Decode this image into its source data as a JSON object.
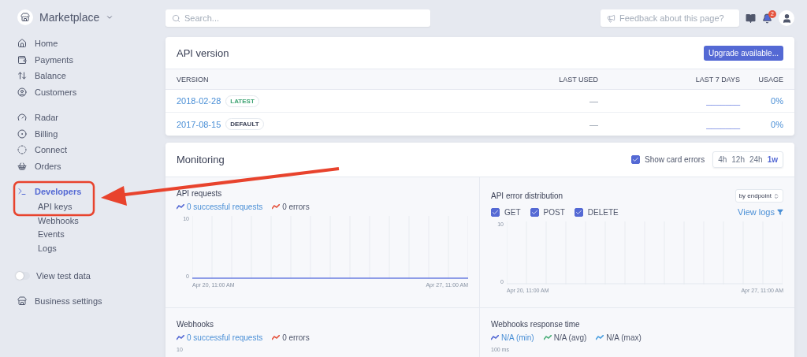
{
  "sidebar": {
    "account": "Marketplace",
    "groups": [
      [
        {
          "label": "Home",
          "selected": false
        },
        {
          "label": "Payments",
          "selected": false
        },
        {
          "label": "Balance",
          "selected": false
        },
        {
          "label": "Customers",
          "selected": false
        }
      ],
      [
        {
          "label": "Radar",
          "selected": false
        },
        {
          "label": "Billing",
          "selected": false
        },
        {
          "label": "Connect",
          "selected": false
        },
        {
          "label": "Orders",
          "selected": false
        }
      ],
      [
        {
          "label": "Developers",
          "selected": true,
          "children": [
            {
              "label": "API keys",
              "selected": false
            },
            {
              "label": "Webhooks",
              "selected": false
            },
            {
              "label": "Events",
              "selected": false
            },
            {
              "label": "Logs",
              "selected": false
            }
          ]
        }
      ]
    ],
    "test_data": {
      "label": "View test data",
      "on": false
    },
    "settings": {
      "label": "Business settings"
    }
  },
  "topbar": {
    "search": {
      "placeholder": "Search..."
    },
    "feedback": {
      "placeholder": "Feedback about this page?"
    },
    "notifications": "2"
  },
  "api_version": {
    "title": "API version",
    "button": "Upgrade available...",
    "columns": [
      "VERSION",
      "LAST USED",
      "LAST 7 DAYS",
      "USAGE"
    ],
    "rows": [
      {
        "version": "2018-02-28",
        "badge": {
          "text": "LATEST",
          "kind": "latest"
        },
        "last_used": "—",
        "last_7_days": "_______",
        "usage": "0%"
      },
      {
        "version": "2017-08-15",
        "badge": {
          "text": "DEFAULT",
          "kind": "default"
        },
        "last_used": "—",
        "last_7_days": "_______",
        "usage": "0%"
      }
    ]
  },
  "monitoring": {
    "title": "Monitoring",
    "show_card_errors": {
      "label": "Show card errors",
      "checked": true
    },
    "ranges": [
      {
        "label": "4h",
        "selected": false
      },
      {
        "label": "12h",
        "selected": false
      },
      {
        "label": "24h",
        "selected": false
      },
      {
        "label": "1w",
        "selected": true
      }
    ],
    "panels": [
      {
        "kind": "line",
        "title": "API requests",
        "legend": [
          {
            "text": "0 successful requests",
            "color": "#5469d4"
          },
          {
            "text": "0 errors",
            "color": "#e5533d"
          }
        ],
        "y_ticks": [
          "10",
          "0"
        ],
        "x_labels": [
          "Apr 20, 11:00 AM",
          "Apr 27, 11:00 AM"
        ]
      },
      {
        "kind": "distribution",
        "title": "API error distribution",
        "select": "by endpoint",
        "link": "View logs",
        "filters": [
          {
            "label": "GET",
            "checked": true
          },
          {
            "label": "POST",
            "checked": true
          },
          {
            "label": "DELETE",
            "checked": true
          }
        ],
        "y_ticks": [
          "10",
          "0"
        ],
        "x_labels": [
          "Apr 20, 11:00 AM",
          "Apr 27, 11:00 AM"
        ]
      },
      {
        "kind": "partial",
        "title": "Webhooks",
        "legend": [
          {
            "text": "0 successful requests",
            "color": "#5469d4"
          },
          {
            "text": "0 errors",
            "color": "#e5533d"
          }
        ],
        "y_ticks": [
          "10"
        ]
      },
      {
        "kind": "partial",
        "title": "Webhooks response time",
        "legend": [
          {
            "text": "N/A (min)",
            "color": "#5469d4"
          },
          {
            "text": "N/A (avg)",
            "color": "#4caf7a"
          },
          {
            "text": "N/A (max)",
            "color": "#4a9fe0"
          }
        ],
        "y_ticks": [
          "100 ms"
        ]
      }
    ]
  }
}
